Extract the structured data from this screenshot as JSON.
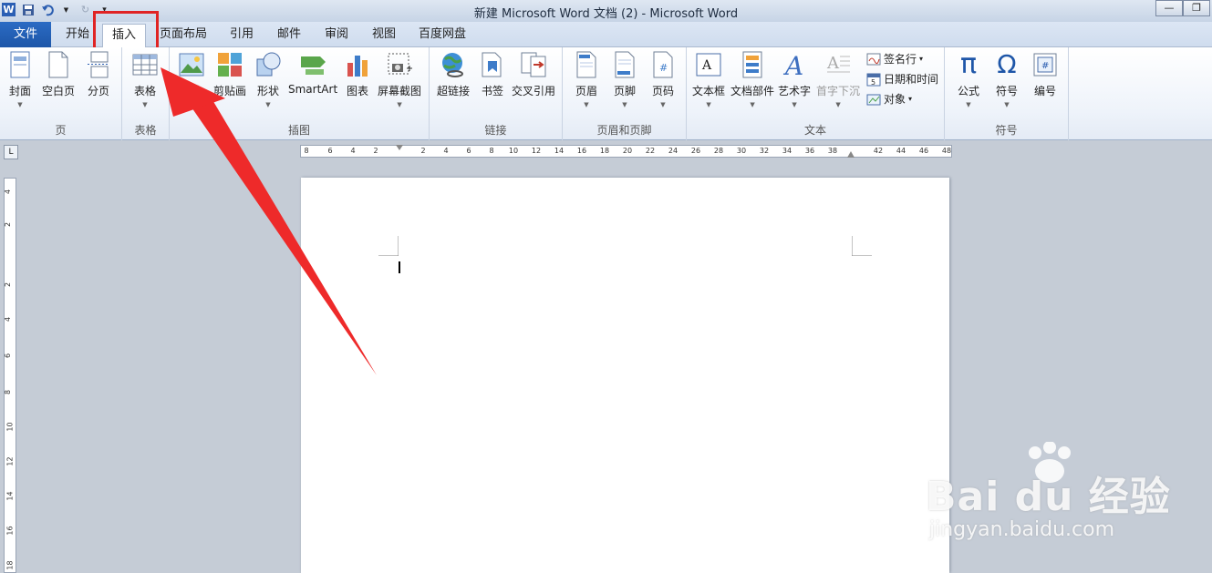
{
  "window": {
    "title": "新建 Microsoft Word 文档 (2)  -  Microsoft Word",
    "app_icon": "W"
  },
  "tabs": [
    {
      "label": "文件"
    },
    {
      "label": "开始"
    },
    {
      "label": "插入"
    },
    {
      "label": "页面布局"
    },
    {
      "label": "引用"
    },
    {
      "label": "邮件"
    },
    {
      "label": "审阅"
    },
    {
      "label": "视图"
    },
    {
      "label": "百度网盘"
    }
  ],
  "ribbon": {
    "groups": {
      "pages": {
        "label": "页",
        "buttons": [
          "封面",
          "空白页",
          "分页"
        ]
      },
      "tables": {
        "label": "表格",
        "buttons": [
          "表格"
        ]
      },
      "illustrations": {
        "label": "插图",
        "buttons": [
          "图片",
          "剪贴画",
          "形状",
          "SmartArt",
          "图表",
          "屏幕截图"
        ]
      },
      "links": {
        "label": "链接",
        "buttons": [
          "超链接",
          "书签",
          "交叉引用"
        ]
      },
      "header_footer": {
        "label": "页眉和页脚",
        "buttons": [
          "页眉",
          "页脚",
          "页码"
        ]
      },
      "text": {
        "label": "文本",
        "buttons": [
          "文本框",
          "文档部件",
          "艺术字",
          "首字下沉"
        ],
        "small": [
          "签名行",
          "日期和时间",
          "对象"
        ]
      },
      "symbols": {
        "label": "符号",
        "buttons": [
          "公式",
          "符号",
          "编号"
        ]
      }
    }
  },
  "ruler": {
    "h_ticks": [
      "8",
      "6",
      "4",
      "2",
      "2",
      "4",
      "6",
      "8",
      "10",
      "12",
      "14",
      "16",
      "18",
      "20",
      "22",
      "24",
      "26",
      "28",
      "30",
      "32",
      "34",
      "36",
      "38",
      "42",
      "44",
      "46",
      "48"
    ],
    "v_ticks": [
      "4",
      "2",
      "2",
      "4",
      "6",
      "8",
      "10",
      "12",
      "14",
      "16",
      "18"
    ],
    "corner_mark": "L"
  },
  "watermark": {
    "brand": "Bai du 经验",
    "url": "jingyan.baidu.com"
  },
  "colors": {
    "file_tab": "#1d56a8",
    "highlight": "#e02424",
    "arrow": "#ee2a2a"
  }
}
